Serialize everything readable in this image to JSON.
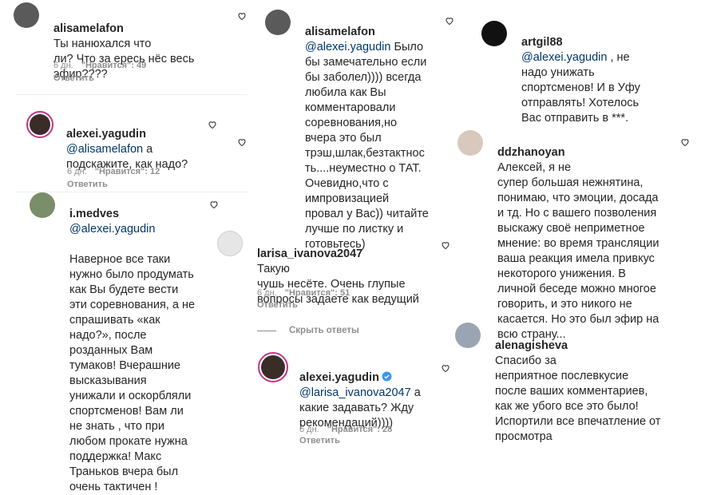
{
  "comments": {
    "c1": {
      "user": "alisamelafon",
      "text": "Ты нанюхался что\nли? Что за ересь нёс весь\nэфир????",
      "time": "6 дн.",
      "likes": "\"Нравится\": 49",
      "reply": "Ответить"
    },
    "c2": {
      "user": "alexei.yagudin",
      "mention": "@alisamelafon",
      "text": " а\nподскажите, как надо?",
      "time": "6 дн.",
      "likes": "\"Нравится\": 12",
      "reply": "Ответить"
    },
    "c3": {
      "user": "i.medves",
      "mention": "@alexei.yagudin",
      "text": "Наверное все таки\nнужно было продумать\nкак Вы будете вести\nэти соревнования, а не\nспрашивать «как\nнадо?», после\nрозданных Вам\nтумаков! Вчерашние\nвысказывания\nунижали и оскорбляли\nспортсменов! Вам ли\nне знать , что при\nлюбом прокате нужна\nподдержка! Макс\nТраньков вчера был\nочень тактичен !"
    },
    "c4": {
      "user": "alisamelafon",
      "mention": "@alexei.yagudin",
      "text": " Было\nбы замечательно если\nбы заболел)))) всегда\nлюбила как Вы\nкомментаровали\nсоревнования,но\nвчера это был\nтрэш,шлак,безтактнос\nть....неуместно о ТАТ.\nОчевидно,что с\nимпровизацией\nпровал у Вас)) читайте\nлучше по листку и\nготовьтесь)"
    },
    "c5": {
      "user": "larisa_ivanova2047",
      "text": " Такую\nчушь несёте. Очень глупые\nвопросы задаете как ведущий",
      "time": "6 дн.",
      "likes": "\"Нравится\": 51",
      "reply": "Ответить"
    },
    "hide_replies": "Скрыть ответы",
    "c6": {
      "user": "alexei.yagudin",
      "mention": "@larisa_ivanova2047",
      "text": " а\nкакие задавать? Жду\nрекомендаций))))",
      "time": "6 дн.",
      "likes": "\"Нравится\": 28",
      "reply": "Ответить"
    },
    "c7": {
      "user": "artgil88",
      "mention": "@alexei.yagudin",
      "text": " , не\nнадо унижать\nспортсменов! И в Уфу\nотправлять! Хотелось\nВас отправить в ***."
    },
    "c8": {
      "user": "ddzhanoyan",
      "text": " Алексей, я не\nсупер большая нежнятина,\nпонимаю, что эмоции, досада\nи тд. Но с вашего позволения\nвыскажу своё неприметное\nмнение: во время трансляции\nваша реакция имела привкус\nнекоторого унижения. В\nличной беседе можно многое\nговорить, и это никого не\nкасается. Но это был эфир на\nвсю страну..."
    },
    "c9": {
      "user": "alenagisheva",
      "text": " Спасибо за\nнеприятное послевкусие\nпосле ваших комментариев,\nкак же убого все это было!\nИспортили все впечатление от\nпросмотра"
    }
  },
  "colors": {
    "text": "#262626",
    "mention": "#00376b",
    "meta": "#8e8e8e",
    "verified": "#3897f0",
    "ring": "#c13584"
  },
  "icons": [
    "heart-icon",
    "verified-badge-icon"
  ]
}
